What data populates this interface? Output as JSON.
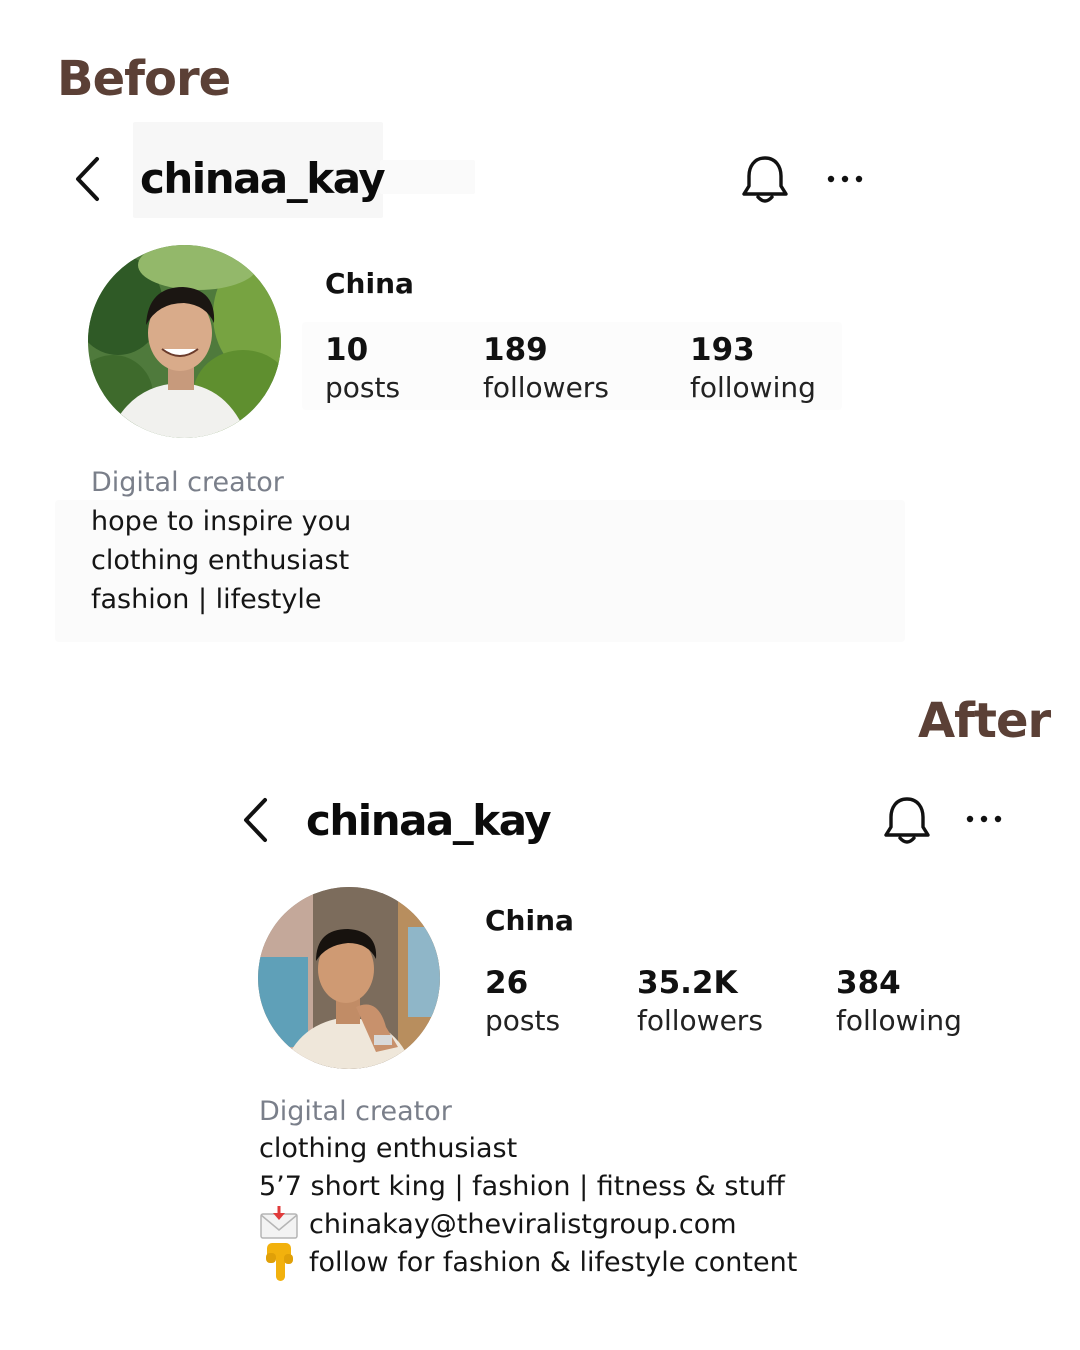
{
  "before": {
    "label": "Before",
    "username": "chinaa_kay",
    "name": "China",
    "stats": {
      "posts": {
        "value": "10",
        "label": "posts"
      },
      "followers": {
        "value": "189",
        "label": "followers"
      },
      "following": {
        "value": "193",
        "label": "following"
      }
    },
    "bio": {
      "category": "Digital creator",
      "lines": [
        "hope to inspire you",
        "clothing enthusiast",
        "fashion | lifestyle"
      ]
    }
  },
  "after": {
    "label": "After",
    "username": "chinaa_kay",
    "name": "China",
    "stats": {
      "posts": {
        "value": "26",
        "label": "posts"
      },
      "followers": {
        "value": "35.2K",
        "label": "followers"
      },
      "following": {
        "value": "384",
        "label": "following"
      }
    },
    "bio": {
      "category": "Digital creator",
      "lines": [
        "clothing enthusiast",
        "5’7 short king | fashion | fitness & stuff",
        "chinakay@theviralistgroup.com",
        "follow for fashion & lifestyle content"
      ],
      "line_icons": [
        "",
        "",
        "envelope-emoji",
        "pointing-down-emoji"
      ]
    }
  },
  "icons": {
    "back": "chevron-left-icon",
    "notifications": "bell-icon",
    "more": "more-dots-icon"
  },
  "colors": {
    "label": "#5b4036",
    "text": "#111111",
    "muted": "#7a7f8a"
  }
}
